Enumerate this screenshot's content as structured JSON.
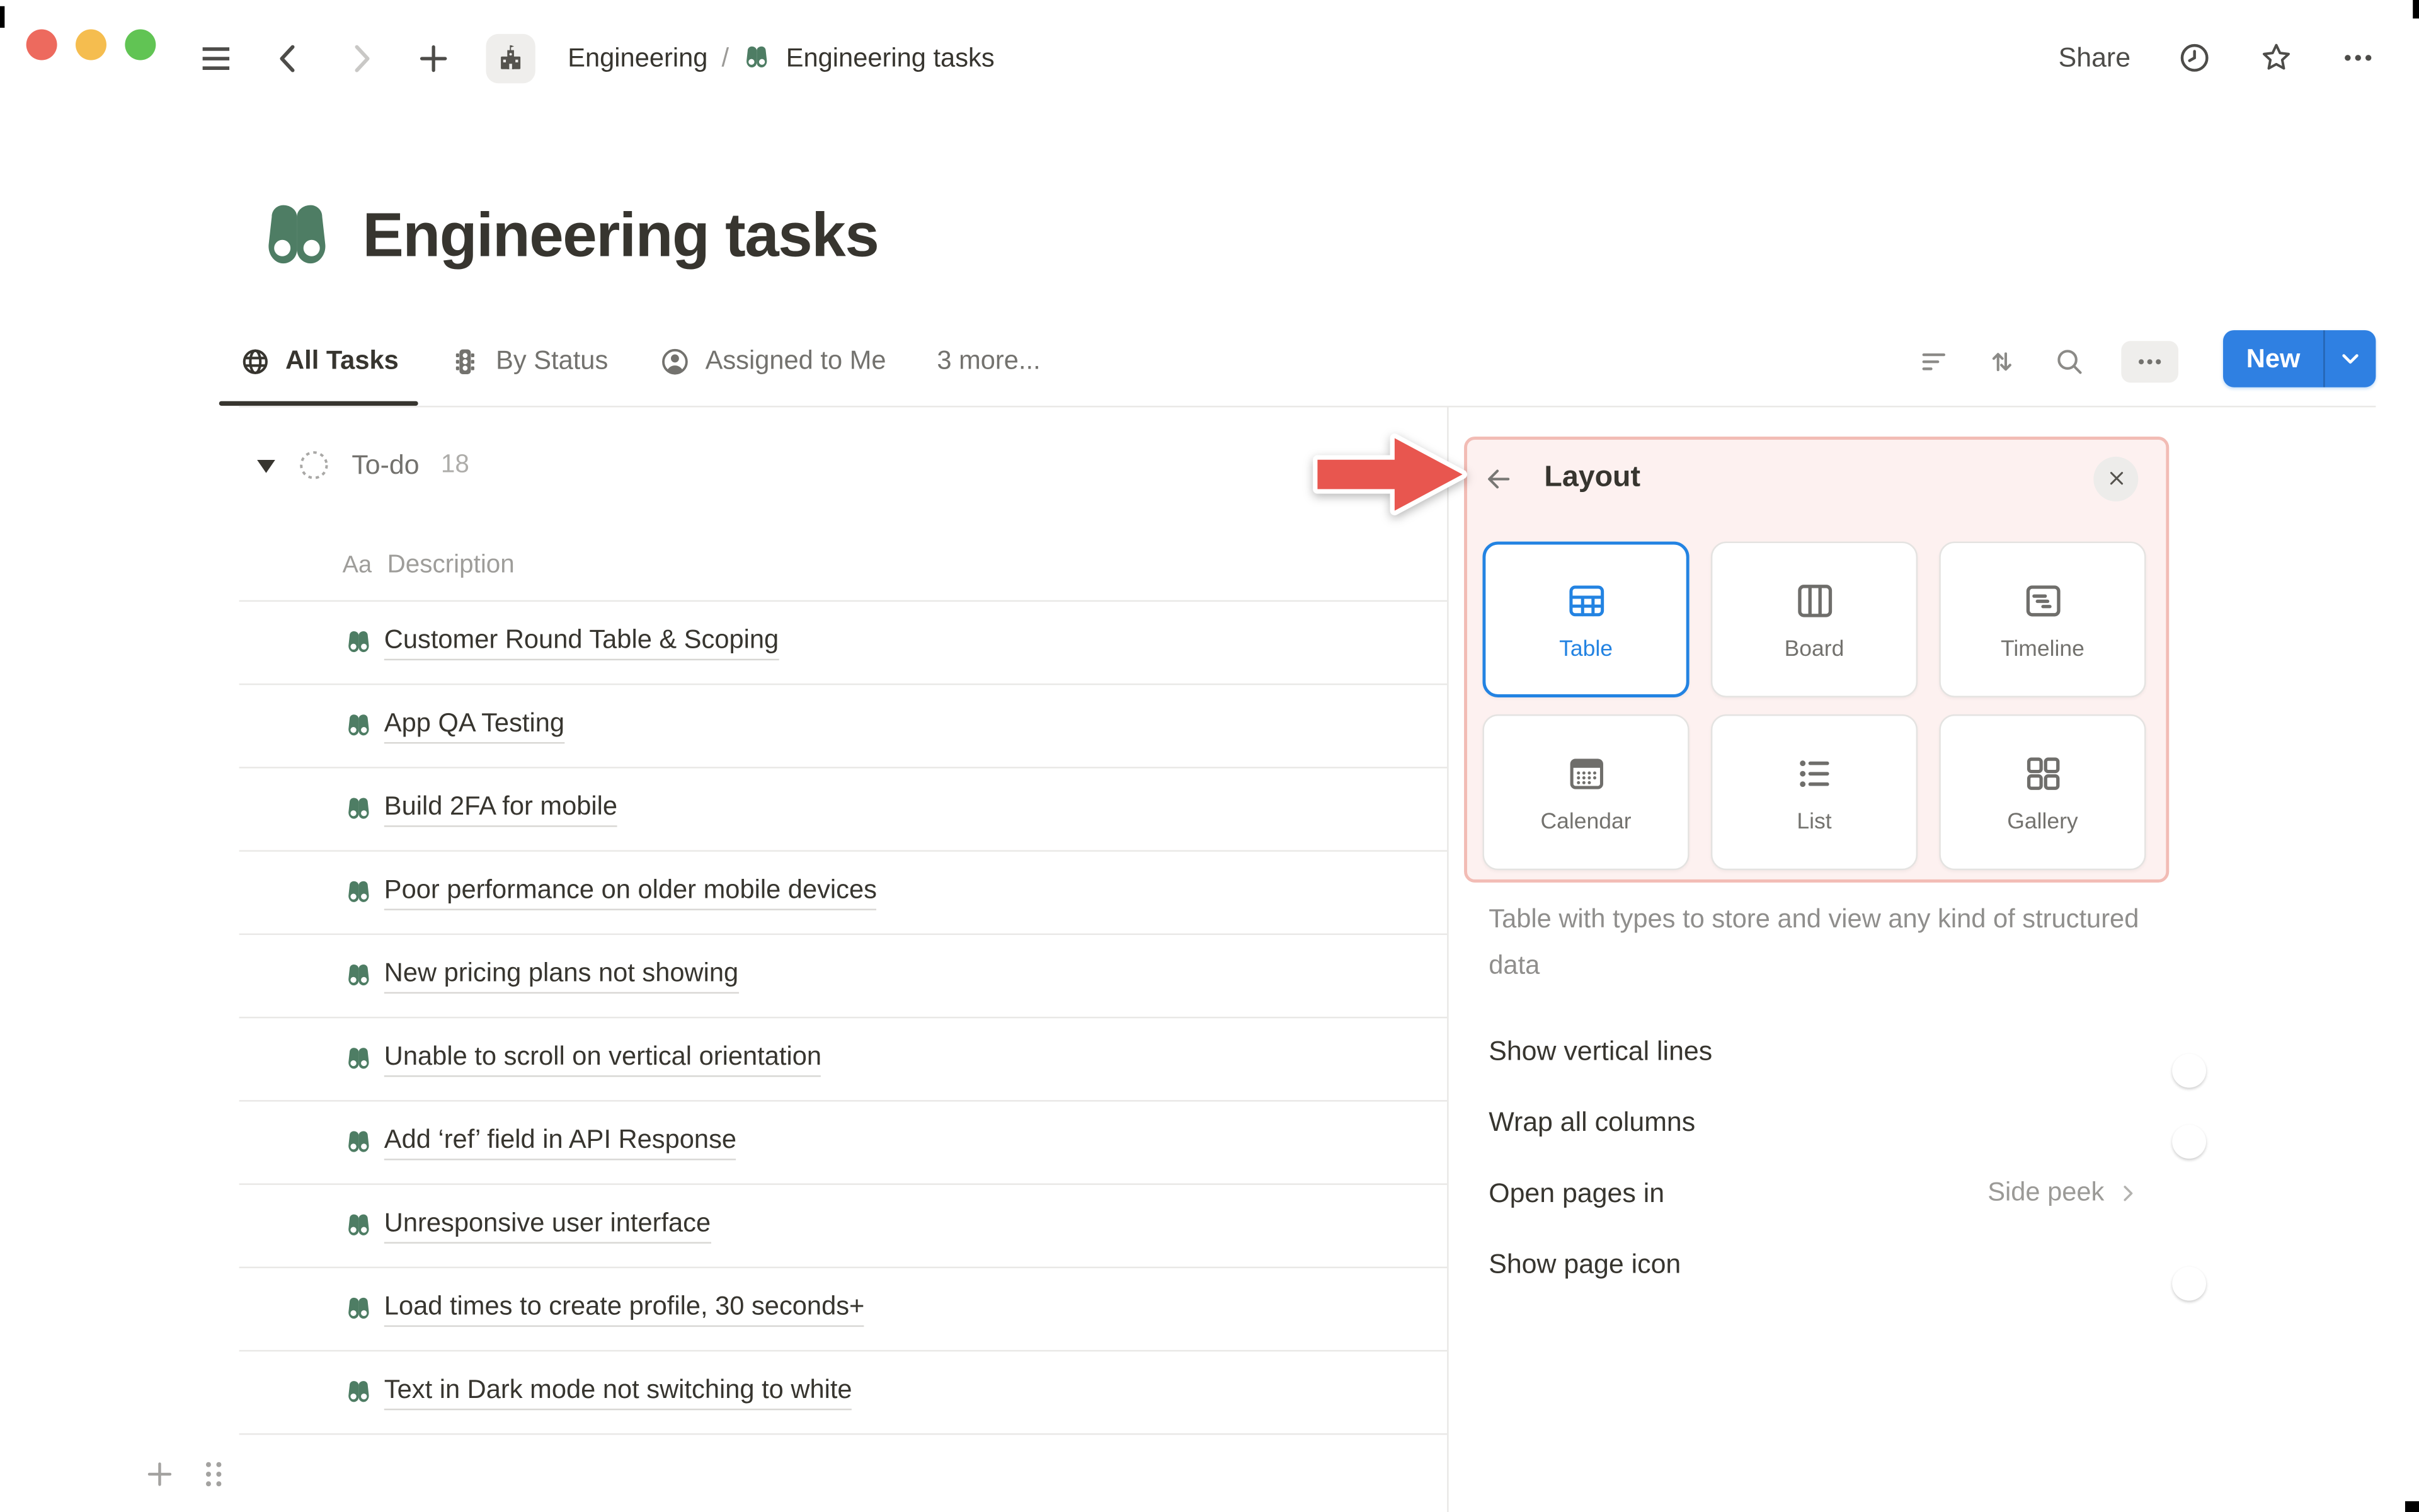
{
  "topbar": {
    "breadcrumb_workspace": "Engineering",
    "breadcrumb_separator": "/",
    "breadcrumb_page": "Engineering tasks",
    "share_label": "Share"
  },
  "page": {
    "title": "Engineering tasks"
  },
  "view_tabs": [
    {
      "label": "All Tasks",
      "icon": "globe-icon",
      "active": true
    },
    {
      "label": "By Status",
      "icon": "traffic-light-icon",
      "active": false
    },
    {
      "label": "Assigned to Me",
      "icon": "person-icon",
      "active": false
    },
    {
      "label": "3 more...",
      "icon": null,
      "active": false
    }
  ],
  "toolbar": {
    "new_label": "New"
  },
  "table": {
    "group_label": "To-do",
    "group_count": "18",
    "property_type_label": "Aa",
    "property_label": "Description",
    "tasks": [
      "Customer Round Table & Scoping",
      "App QA Testing",
      "Build 2FA for mobile",
      "Poor performance on older mobile devices",
      "New pricing plans not showing",
      "Unable to scroll on vertical orientation",
      "Add ‘ref’ field in API Response",
      "Unresponsive user interface",
      "Load times to create profile, 30 seconds+",
      "Text in Dark mode not switching to white"
    ]
  },
  "layout_panel": {
    "title": "Layout",
    "options": [
      {
        "label": "Table",
        "icon": "table-icon",
        "selected": true
      },
      {
        "label": "Board",
        "icon": "board-icon",
        "selected": false
      },
      {
        "label": "Timeline",
        "icon": "timeline-icon",
        "selected": false
      },
      {
        "label": "Calendar",
        "icon": "calendar-icon",
        "selected": false
      },
      {
        "label": "List",
        "icon": "list-icon",
        "selected": false
      },
      {
        "label": "Gallery",
        "icon": "gallery-icon",
        "selected": false
      }
    ],
    "description": "Table with types to store and view any kind of structured data",
    "settings": [
      {
        "label": "Show vertical lines",
        "control": "toggle",
        "value": true
      },
      {
        "label": "Wrap all columns",
        "control": "toggle",
        "value": true
      },
      {
        "label": "Open pages in",
        "control": "link",
        "value": "Side peek"
      },
      {
        "label": "Show page icon",
        "control": "toggle",
        "value": true
      }
    ]
  },
  "colors": {
    "accent_blue": "#2383e2",
    "button_blue": "#2f80e2",
    "page_icon_green": "#4e7d64",
    "highlight_pink_bg": "#fdf1f0",
    "highlight_pink_border": "#f2bcb5",
    "annotation_red": "#e8564f",
    "traffic_red": "#ed6a5e",
    "traffic_yellow": "#f5bd4f",
    "traffic_green": "#61c454"
  }
}
